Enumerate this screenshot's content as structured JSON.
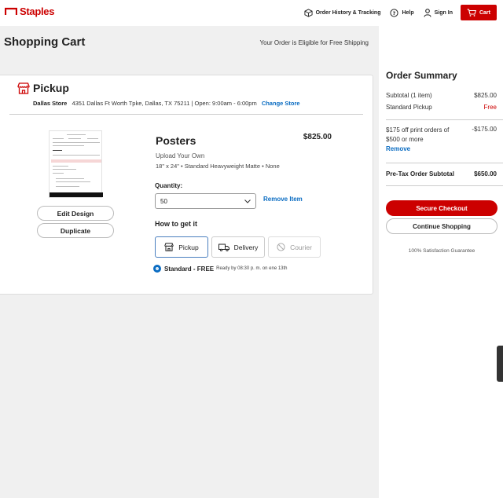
{
  "header": {
    "logo": "Staples",
    "nav": {
      "order_history": "Order History & Tracking",
      "help": "Help",
      "sign_in": "Sign In",
      "cart": "Cart"
    }
  },
  "page": {
    "title": "Shopping Cart",
    "eligible": "Your Order is Eligible for Free Shipping"
  },
  "pickup": {
    "title": "Pickup",
    "store_name": "Dallas Store",
    "store_details": "4351 Dallas Ft Worth Tpke, Dallas, TX 75211 | Open: 9:00am - 6:00pm",
    "change_store": "Change Store"
  },
  "item": {
    "name": "Posters",
    "price": "$825.00",
    "subtitle": "Upload Your Own",
    "spec": "18\" x 24\" • Standard Heavyweight Matte • None",
    "quantity_label": "Quantity:",
    "quantity_value": "50",
    "remove": "Remove Item",
    "edit_design": "Edit Design",
    "duplicate": "Duplicate"
  },
  "fulfillment": {
    "label": "How to get it",
    "options": [
      "Pickup",
      "Delivery",
      "Courier"
    ],
    "selected": "Pickup",
    "standard_label": "Standard - FREE",
    "ready_text": "Ready by 08:30 p. m. on ene 13th"
  },
  "summary": {
    "title": "Order Summary",
    "subtotal_label": "Subtotal (1 item)",
    "subtotal_value": "$825.00",
    "pickup_label": "Standard Pickup",
    "pickup_value": "Free",
    "promo_label": "$175 off print orders of $500 or more",
    "promo_value": "-$175.00",
    "promo_remove": "Remove",
    "pretax_label": "Pre-Tax Order Subtotal",
    "pretax_value": "$650.00",
    "checkout": "Secure Checkout",
    "continue": "Continue Shopping",
    "guarantee": "100% Satisfaction Guarantee"
  },
  "colors": {
    "brand_red": "#cc0000",
    "link_blue": "#0a6cc2"
  }
}
